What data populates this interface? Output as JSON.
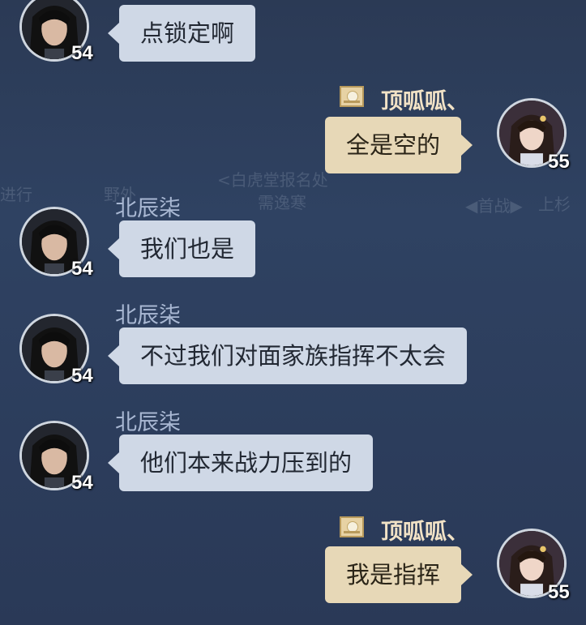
{
  "background_hints": [
    "进行",
    "野外",
    "<白虎堂报名处",
    "需逸寒",
    "◀首战▶",
    "上杉"
  ],
  "colors": {
    "left_bubble": "#cfd8e6",
    "right_bubble": "#e7d8b7",
    "left_name": "#a9b8d3",
    "right_name": "#f1e2c6"
  },
  "messages": [
    {
      "side": "left",
      "sender": "",
      "level": "54",
      "text": "点锁定啊",
      "avatar": "male-swordsman-avatar"
    },
    {
      "side": "right",
      "sender": "顶呱呱、",
      "level": "55",
      "text": "全是空的",
      "avatar": "female-avatar",
      "badge": "sun-badge-icon"
    },
    {
      "side": "left",
      "sender": "北辰柒",
      "level": "54",
      "text": "我们也是",
      "avatar": "male-swordsman-avatar"
    },
    {
      "side": "left",
      "sender": "北辰柒",
      "level": "54",
      "text": "不过我们对面家族指挥不太会",
      "avatar": "male-swordsman-avatar"
    },
    {
      "side": "left",
      "sender": "北辰柒",
      "level": "54",
      "text": "他们本来战力压到的",
      "avatar": "male-swordsman-avatar"
    },
    {
      "side": "right",
      "sender": "顶呱呱、",
      "level": "55",
      "text": "我是指挥",
      "avatar": "female-avatar",
      "badge": "sun-badge-icon"
    }
  ]
}
